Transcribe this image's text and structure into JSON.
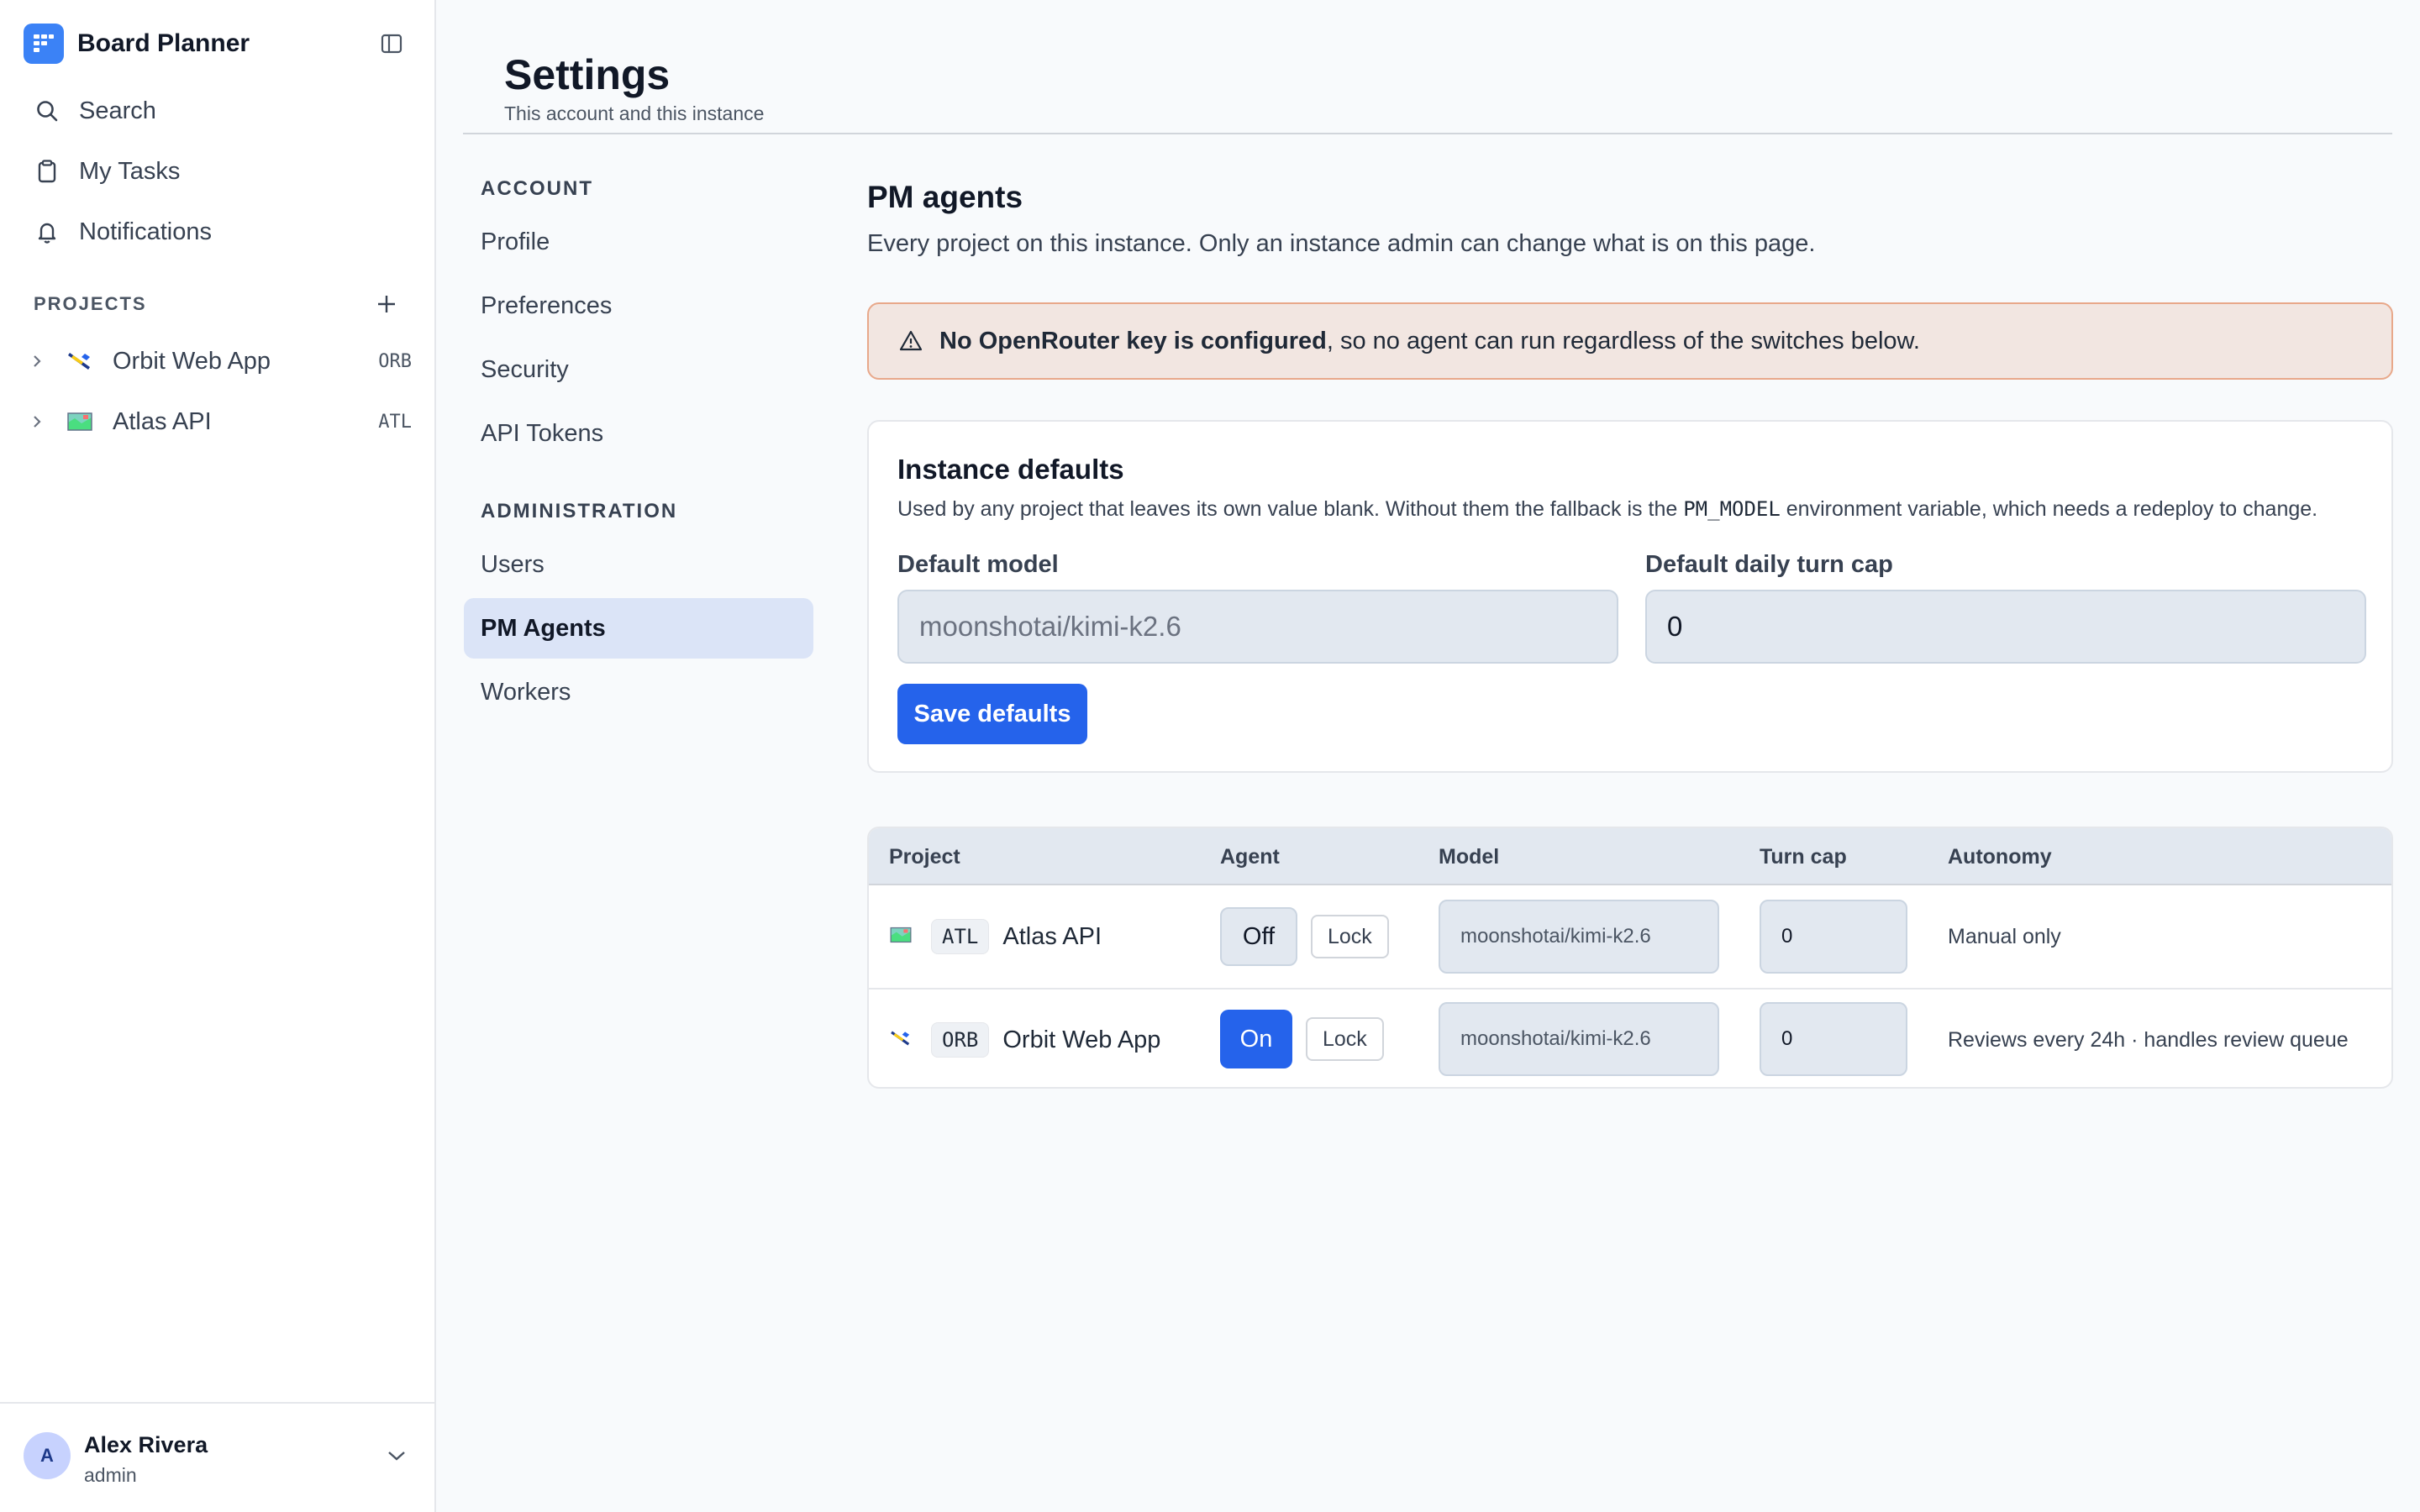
{
  "app": {
    "name": "Board Planner"
  },
  "sidebar": {
    "nav": [
      {
        "label": "Search",
        "icon": "search-icon"
      },
      {
        "label": "My Tasks",
        "icon": "clipboard-icon"
      },
      {
        "label": "Notifications",
        "icon": "bell-icon"
      }
    ],
    "projects_heading": "PROJECTS",
    "projects": [
      {
        "name": "Orbit Web App",
        "key": "ORB",
        "icon": "flag-icon"
      },
      {
        "name": "Atlas API",
        "key": "ATL",
        "icon": "map-icon"
      }
    ],
    "user": {
      "initial": "A",
      "name": "Alex Rivera",
      "role": "admin"
    }
  },
  "header": {
    "title": "Settings",
    "subtitle": "This account and this instance"
  },
  "settings_nav": {
    "account_heading": "ACCOUNT",
    "account_items": [
      "Profile",
      "Preferences",
      "Security",
      "API Tokens"
    ],
    "admin_heading": "ADMINISTRATION",
    "admin_items": [
      "Users",
      "PM Agents",
      "Workers"
    ],
    "active": "PM Agents"
  },
  "main": {
    "title": "PM agents",
    "description": "Every project on this instance. Only an instance admin can change what is on this page.",
    "alert": {
      "bold": "No OpenRouter key is configured",
      "rest": ", so no agent can run regardless of the switches below."
    },
    "defaults": {
      "title": "Instance defaults",
      "desc_before": "Used by any project that leaves its own value blank. Without them the fallback is the ",
      "desc_code": "PM_MODEL",
      "desc_after": " environment variable, which needs a redeploy to change.",
      "model_label": "Default model",
      "model_value": "moonshotai/kimi-k2.6",
      "cap_label": "Default daily turn cap",
      "cap_value": "0",
      "save_label": "Save defaults"
    },
    "table": {
      "headers": {
        "project": "Project",
        "agent": "Agent",
        "model": "Model",
        "turn_cap": "Turn cap",
        "autonomy": "Autonomy"
      },
      "rows": [
        {
          "key": "ATL",
          "name": "Atlas API",
          "agent": "Off",
          "lock": "Lock",
          "model": "moonshotai/kimi-k2.6",
          "turn_cap": "0",
          "autonomy": "Manual only"
        },
        {
          "key": "ORB",
          "name": "Orbit Web App",
          "agent": "On",
          "lock": "Lock",
          "model": "moonshotai/kimi-k2.6",
          "turn_cap": "0",
          "autonomy": "Reviews every 24h · handles review queue"
        }
      ]
    }
  },
  "colors": {
    "accent": "#2563eb",
    "brand": "#3b82f6",
    "alert_bg": "#f2e6e1",
    "alert_border": "#e8a88a",
    "active_nav": "#dbe4f7"
  }
}
